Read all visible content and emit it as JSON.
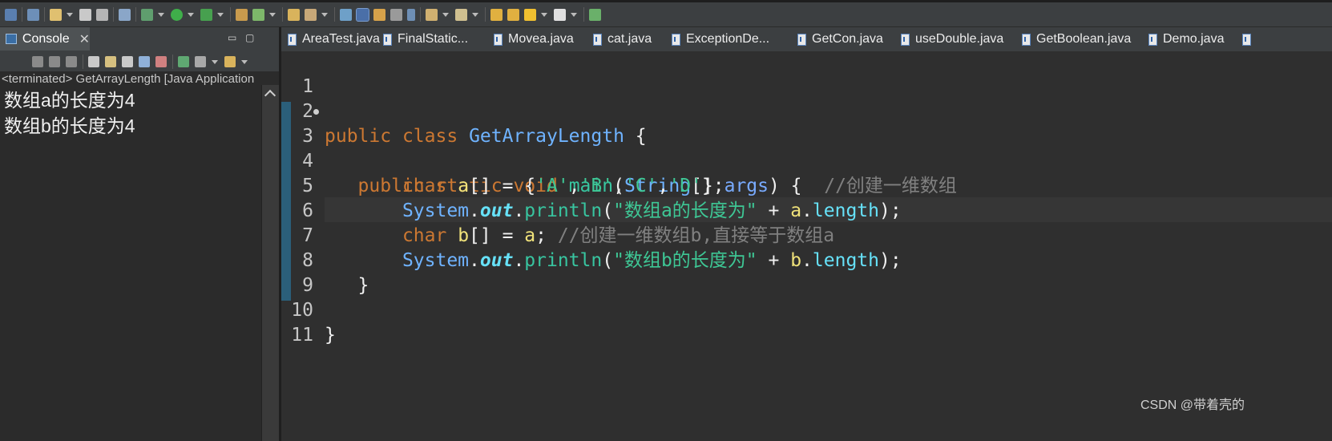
{
  "toolbar": {
    "icons": [
      "new-view-icon",
      "separator-icon",
      "new-wizard-icon",
      "save-icon",
      "save-all-icon",
      "binary-icon",
      "debug-icon",
      "run-icon",
      "run-tool-icon",
      "open-type-icon",
      "refresh-icon",
      "open-folder-icon",
      "brush-icon",
      "flag-icon",
      "highlight-icon",
      "toggle-icon",
      "list-icon",
      "pilcrow-icon",
      "collapse-icon",
      "expand-icon",
      "back-icon",
      "forward-icon",
      "prev-icon",
      "next-icon",
      "terminal-icon"
    ]
  },
  "console": {
    "tab_title": "Console",
    "close_glyph": "✕",
    "minimize_glyph": "▭",
    "maximize_glyph": "▢",
    "status": "<terminated> GetArrayLength [Java Application",
    "output": [
      "数组a的长度为4",
      "数组b的长度为4"
    ]
  },
  "editor": {
    "tabs": [
      {
        "label": "AreaTest.java"
      },
      {
        "label": "FinalStatic..."
      },
      {
        "label": "Movea.java"
      },
      {
        "label": "cat.java"
      },
      {
        "label": "ExceptionDe..."
      },
      {
        "label": "GetCon.java"
      },
      {
        "label": "useDouble.java"
      },
      {
        "label": "GetBoolean.java"
      },
      {
        "label": "Demo.java"
      }
    ],
    "line_numbers": [
      "1",
      "2",
      "3",
      "4",
      "5",
      "6",
      "7",
      "8",
      "9",
      "10",
      "11"
    ],
    "code": {
      "l2": {
        "kw1": "public",
        "kw2": "class",
        "cls": "GetArrayLength",
        "rest": " {"
      },
      "l3": {
        "kw1": "public",
        "kw2": "static",
        "kw3": "void",
        "mtd": "main",
        "p1": "(",
        "type": "String",
        "p2": "[] ",
        "prm": "args",
        "p3": ") {  ",
        "cmt": "//创建一维数组"
      },
      "l4": {
        "kw": "char",
        "var": "a",
        "p1": "[] = {",
        "s1": "'A'",
        "s2": "'B'",
        "s3": "'C'",
        "s4": "'D'",
        "comma": ",",
        "p2": "};"
      },
      "l5": {
        "cls": "System",
        "dot": ".",
        "fld": "out",
        "mtd": "println",
        "p1": "(",
        "str": "\"数组a的长度为\"",
        "op": " + ",
        "var": "a",
        "fld2": "length",
        "end": ");"
      },
      "l6": {
        "kw": "char",
        "var1": "b",
        "p1": "[] = ",
        "var2": "a",
        "p2": "; ",
        "cmt": "//创建一维数组b,直接等于数组a"
      },
      "l7": {
        "cls": "System",
        "dot": ".",
        "fld": "out",
        "mtd": "println",
        "p1": "(",
        "str": "\"数组b的长度为\"",
        "op": " + ",
        "var": "b",
        "fld2": "length",
        "end": ");"
      },
      "l8": {
        "text": "}"
      },
      "l10": {
        "text": "}"
      }
    }
  },
  "watermark": "CSDN @带着壳的"
}
